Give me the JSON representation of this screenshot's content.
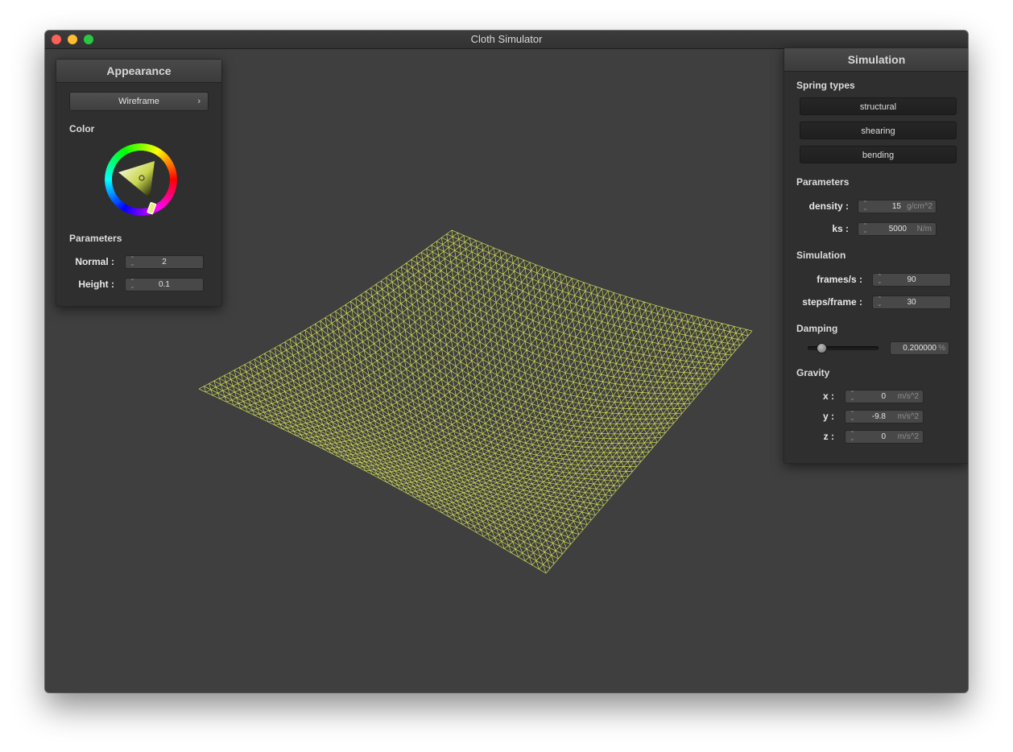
{
  "window": {
    "title": "Cloth Simulator"
  },
  "appearance": {
    "header": "Appearance",
    "shader_select": "Wireframe",
    "color_label": "Color",
    "parameters_label": "Parameters",
    "normal_label": "Normal :",
    "normal_value": "2",
    "height_label": "Height :",
    "height_value": "0.1"
  },
  "simulation_panel": {
    "header": "Simulation",
    "spring_types_label": "Spring types",
    "spring_buttons": [
      "structural",
      "shearing",
      "bending"
    ],
    "parameters_label": "Parameters",
    "density_label": "density :",
    "density_value": "15",
    "density_unit": "g/cm^2",
    "ks_label": "ks :",
    "ks_value": "5000",
    "ks_unit": "N/m",
    "simulation_label": "Simulation",
    "fps_label": "frames/s :",
    "fps_value": "90",
    "steps_label": "steps/frame :",
    "steps_value": "30",
    "damping_label": "Damping",
    "damping_value": "0.200000",
    "damping_unit": "%",
    "damping_fraction": 0.2,
    "gravity_label": "Gravity",
    "gx_label": "x :",
    "gx_value": "0",
    "gy_label": "y :",
    "gy_value": "-9.8",
    "gz_label": "z :",
    "gz_value": "0",
    "gravity_unit": "m/s^2"
  },
  "colors": {
    "cloth": "#d7e05a",
    "background": "#3f3f3f"
  },
  "icons": {
    "close": "close-icon",
    "minimize": "minimize-icon",
    "maximize": "maximize-icon",
    "chevron": "chevron-right-icon",
    "color_wheel": "color-wheel-icon"
  }
}
